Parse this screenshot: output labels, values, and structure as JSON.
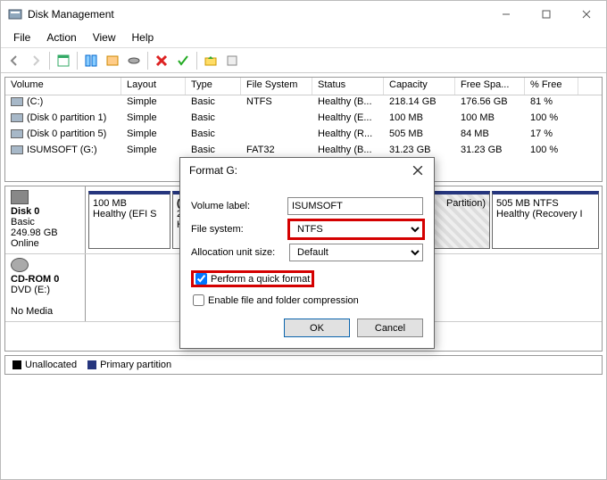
{
  "window_title": "Disk Management",
  "menu": {
    "file": "File",
    "action": "Action",
    "view": "View",
    "help": "Help"
  },
  "columns": [
    "Volume",
    "Layout",
    "Type",
    "File System",
    "Status",
    "Capacity",
    "Free Spa...",
    "% Free"
  ],
  "volumes": [
    {
      "name": "(C:)",
      "layout": "Simple",
      "type": "Basic",
      "fs": "NTFS",
      "status": "Healthy (B...",
      "cap": "218.14 GB",
      "free": "176.56 GB",
      "pct": "81 %"
    },
    {
      "name": "(Disk 0 partition 1)",
      "layout": "Simple",
      "type": "Basic",
      "fs": "",
      "status": "Healthy (E...",
      "cap": "100 MB",
      "free": "100 MB",
      "pct": "100 %"
    },
    {
      "name": "(Disk 0 partition 5)",
      "layout": "Simple",
      "type": "Basic",
      "fs": "",
      "status": "Healthy (R...",
      "cap": "505 MB",
      "free": "84 MB",
      "pct": "17 %"
    },
    {
      "name": "ISUMSOFT (G:)",
      "layout": "Simple",
      "type": "Basic",
      "fs": "FAT32",
      "status": "Healthy (B...",
      "cap": "31.23 GB",
      "free": "31.23 GB",
      "pct": "100 %"
    }
  ],
  "disk0": {
    "label": "Disk 0",
    "type": "Basic",
    "size": "249.98 GB",
    "status": "Online",
    "parts": [
      {
        "line1": "100 MB",
        "line2": "Healthy (EFI S"
      },
      {
        "line1": "(C",
        "line2": "218",
        "line3": "He"
      },
      {
        "line1": "",
        "line2": "Partition)"
      },
      {
        "line1": "505 MB NTFS",
        "line2": "Healthy (Recovery I"
      }
    ]
  },
  "cdrom": {
    "label": "CD-ROM 0",
    "type": "DVD (E:)",
    "status": "No Media"
  },
  "legend": {
    "unalloc": "Unallocated",
    "primary": "Primary partition"
  },
  "dialog": {
    "title": "Format G:",
    "vol_label_lbl": "Volume label:",
    "vol_label_val": "ISUMSOFT",
    "fs_lbl": "File system:",
    "fs_val": "NTFS",
    "aus_lbl": "Allocation unit size:",
    "aus_val": "Default",
    "quick": "Perform a quick format",
    "compress": "Enable file and folder compression",
    "ok": "OK",
    "cancel": "Cancel"
  }
}
